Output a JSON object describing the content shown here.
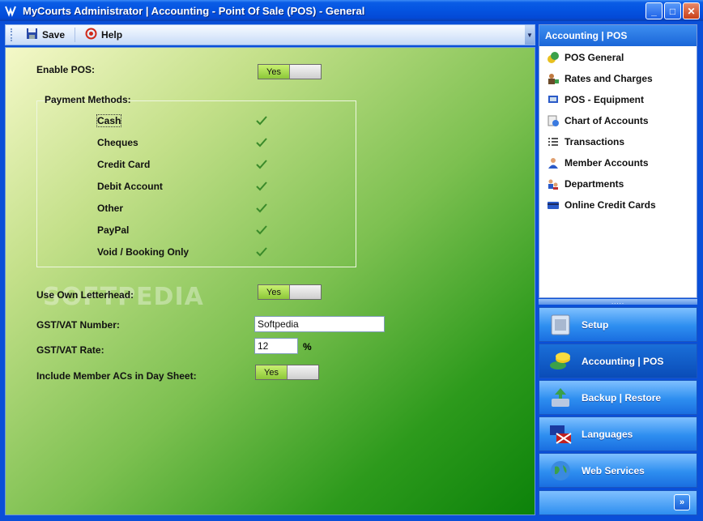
{
  "window": {
    "title": "MyCourts Administrator | Accounting - Point Of Sale (POS) - General"
  },
  "toolbar": {
    "save_label": "Save",
    "help_label": "Help"
  },
  "form": {
    "enable_pos_label": "Enable POS:",
    "enable_pos_value": "Yes",
    "payment_methods_label": "Payment Methods:",
    "payment_methods": [
      "Cash",
      "Cheques",
      "Credit Card",
      "Debit Account",
      "Other",
      "PayPal",
      "Void / Booking Only"
    ],
    "use_own_letterhead_label": "Use Own Letterhead:",
    "use_own_letterhead_value": "Yes",
    "gst_number_label": "GST/VAT Number:",
    "gst_number_value": "Softpedia",
    "gst_rate_label": "GST/VAT Rate:",
    "gst_rate_value": "12",
    "gst_rate_unit": "%",
    "include_member_label": "Include Member ACs in Day Sheet:",
    "include_member_value": "Yes"
  },
  "watermark": "SOFTPEDIA",
  "right_panel": {
    "header": "Accounting | POS",
    "items": [
      "POS General",
      "Rates and Charges",
      "POS - Equipment",
      "Chart of Accounts",
      "Transactions",
      "Member Accounts",
      "Departments",
      "Online Credit Cards"
    ],
    "splitter_dots": "....."
  },
  "nav_buttons": [
    "Setup",
    "Accounting | POS",
    "Backup | Restore",
    "Languages",
    "Web Services"
  ],
  "colors": {
    "accent": "#0a4fd8",
    "toggle_on": "#a6dc48",
    "content_green": "#2d9a1c"
  }
}
